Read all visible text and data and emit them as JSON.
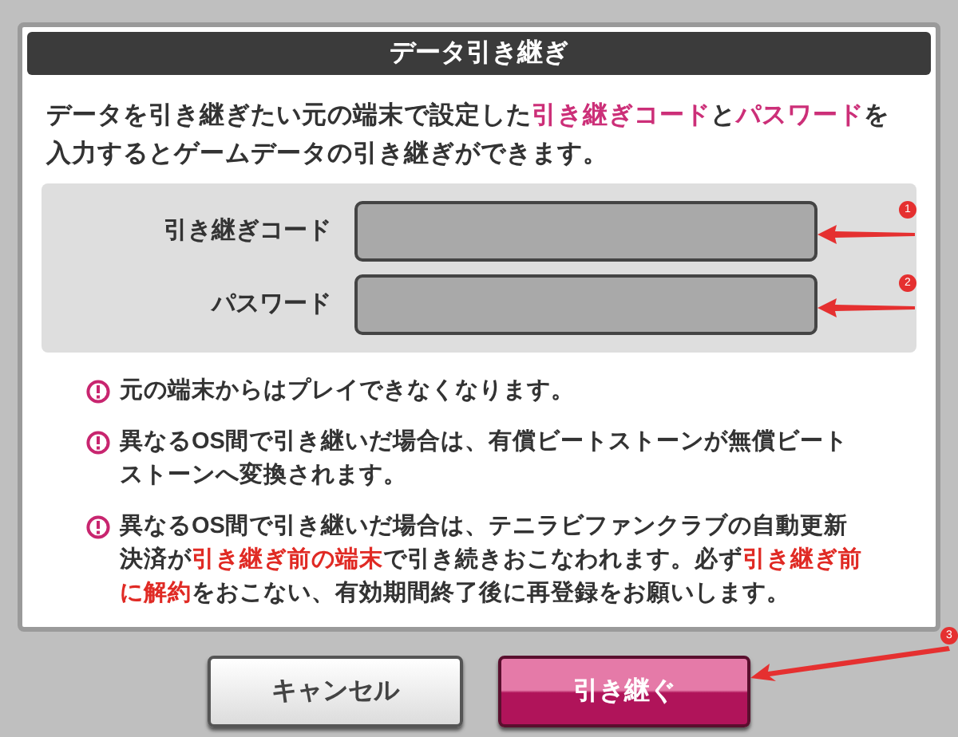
{
  "dialog": {
    "title": "データ引き継ぎ",
    "intro": [
      {
        "text": "データを引き継ぎたい元の端末で設定した",
        "highlight": false
      },
      {
        "text": "引き継ぎコード",
        "highlight": true
      },
      {
        "text": "と",
        "highlight": false
      },
      {
        "text": "パスワード",
        "highlight": true
      },
      {
        "text": "を入力するとゲームデータの引き継ぎができます。",
        "highlight": false
      }
    ],
    "fields": [
      {
        "label": "引き継ぎコード",
        "annotation": "1"
      },
      {
        "label": "パスワード",
        "annotation": "2"
      }
    ],
    "notes": [
      [
        {
          "text": "元の端末からはプレイできなくなります。",
          "highlight": false
        }
      ],
      [
        {
          "text": "異なるOS間で引き継いだ場合は、有償ビートストーンが無償ビートストーンへ変換されます。",
          "highlight": false
        }
      ],
      [
        {
          "text": "異なるOS間で引き継いだ場合は、テニラビファンクラブの自動更新決済が",
          "highlight": false
        },
        {
          "text": "引き継ぎ前の端末",
          "highlight": true
        },
        {
          "text": "で引き続きおこなわれます。必ず",
          "highlight": false
        },
        {
          "text": "引き継ぎ前に解約",
          "highlight": true
        },
        {
          "text": "をおこない、有効期間終了後に再登録をお願いします。",
          "highlight": false
        }
      ]
    ],
    "buttons": [
      {
        "label": "キャンセル",
        "kind": "secondary"
      },
      {
        "label": "引き継ぐ",
        "kind": "primary",
        "annotation": "3"
      }
    ]
  }
}
